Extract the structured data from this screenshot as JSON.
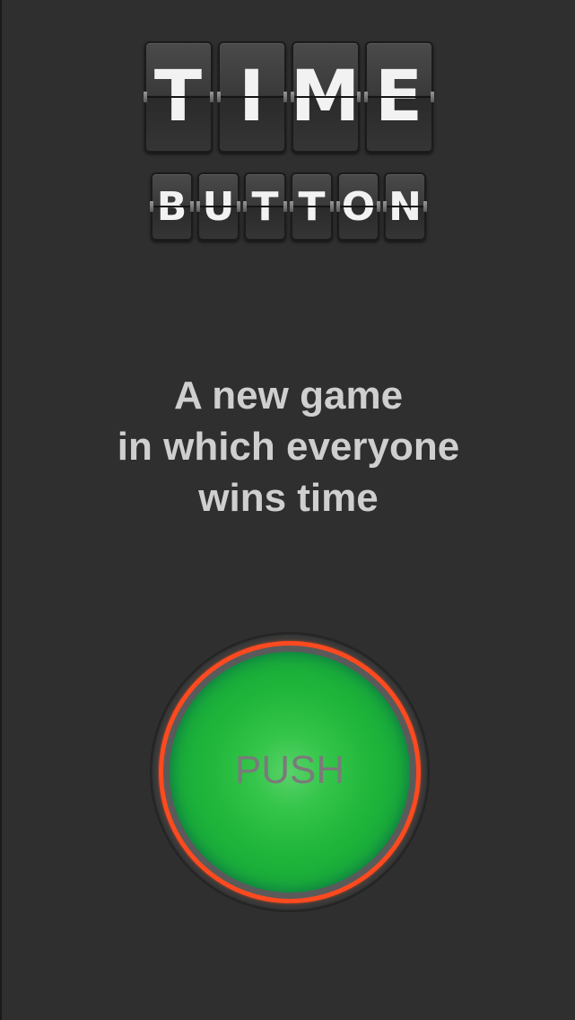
{
  "logo": {
    "title_letters": [
      "T",
      "I",
      "M",
      "E"
    ],
    "subtitle_letters": [
      "B",
      "U",
      "T",
      "T",
      "O",
      "N"
    ]
  },
  "tagline": {
    "line1": "A new game",
    "line2": "in which everyone",
    "line3": "wins time"
  },
  "push_button": {
    "label": "PUSH"
  },
  "colors": {
    "background": "#2f2f2f",
    "tagline_text": "#cfcfcf",
    "button_green": "#1fb53a",
    "button_ring": "#ff4a1f",
    "button_label": "#7a7a7a"
  }
}
